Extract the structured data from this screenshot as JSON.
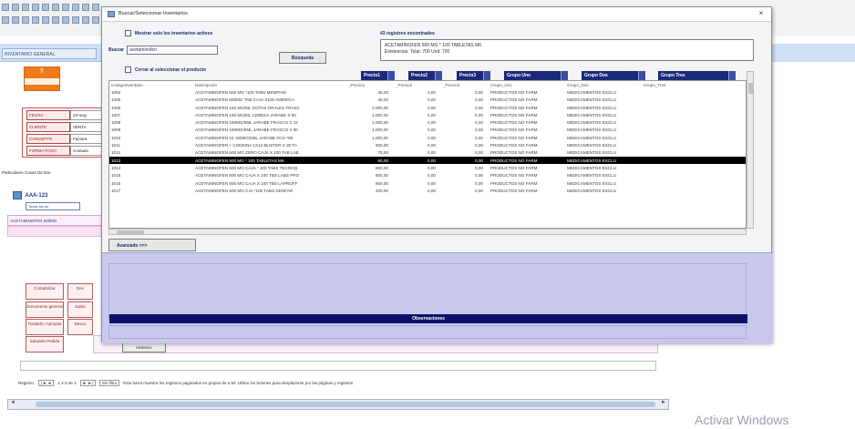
{
  "background": {
    "tab_button": "INVENTARIO GENERAL",
    "badge_top": "T",
    "badge_bottom": "",
    "form_rows": [
      {
        "label": "FECHA",
        "value": "23-may"
      },
      {
        "label": "CLIENTE",
        "value": "VENTA"
      },
      {
        "label": "CONCEPTO",
        "value": "Factura"
      },
      {
        "label": "FORMA PAGO",
        "value": "Contado"
      }
    ],
    "sub_label": "Particulares   Cosas De Dar",
    "account_code": "AAA-123",
    "account_select": "Todas las de",
    "product_row": "ACETAMINOFEN 500MG",
    "side_buttons": [
      {
        "label": "Contabilizar",
        "right": "Dev"
      },
      {
        "label": "Documento general",
        "right": "Gasto"
      },
      {
        "label": "Traslado / Apropiar",
        "right": "Descu"
      },
      {
        "label": "Subsidio Pedido",
        "right": ""
      }
    ],
    "obs_button": "Historico",
    "nav": {
      "label": "Registro:",
      "first": "|◄ ◄",
      "position": "1 2-3 de 3",
      "next": "► ►|",
      "filter": "Sin filtro",
      "message": "Esta barra muestra los registros paginados en grupos de a 50. Utilice los botones para desplazarse por las páginas y registros"
    },
    "watermark": "Activar Windows"
  },
  "modal": {
    "title": "Buscar/Seleccionar Inventarios",
    "close": "×",
    "only_active_label": "Mostrar solo los inventarios activos",
    "search_label": "Buscar",
    "search_value": "acetaminofen",
    "search_button": "Búsqueda",
    "close_on_select_label": "Cerrar al seleccionar el producto",
    "found_label": "43 registros encontrados",
    "found_lines": [
      "ACETAMINOFEN 500 MG * 100 TABLETAS MK",
      "Existencias: Total: 700   Und: 700"
    ],
    "columns": [
      {
        "label": "",
        "key": "code"
      },
      {
        "label": "",
        "key": "desc"
      },
      {
        "label": "Precio1",
        "key": "p1"
      },
      {
        "label": "Precio2",
        "key": "p2"
      },
      {
        "label": "Precio3",
        "key": "p3"
      },
      {
        "label": "Grupo Uno",
        "key": "g1"
      },
      {
        "label": "Grupo Dos",
        "key": "g2"
      },
      {
        "label": "Grupo Tres",
        "key": "g3"
      }
    ],
    "subheader": [
      "CodigoInventario",
      "Descripción",
      "_Precio1",
      "_Precio2",
      "_Precio3",
      "Grupo_Uno",
      "Grupo_Dos",
      "Grupo_Tres"
    ],
    "rows": [
      [
        "1004",
        "ACETAMINOFEN  500 MG *100 TABS MEMPHIS",
        "45,00",
        "0,00",
        "0,00",
        "PRODUCTOS NO FARM",
        "MEDICAMENTOS ESCLU",
        ""
      ],
      [
        "1005",
        "ACETAMINOFEN  500MG TAB CAJA X100 AMERICA",
        "45,00",
        "0,00",
        "0,00",
        "PRODUCTOS NO FARM",
        "MEDICAMENTOS ESCLU",
        ""
      ],
      [
        "1006",
        "ACETAMINOFEN 150 MG/ML GOTAS ORALES FRASC",
        "2.000,00",
        "0,00",
        "0,00",
        "PRODUCTOS NO FARM",
        "MEDICAMENTOS ESCLU",
        ""
      ],
      [
        "1007",
        "ACETAMINOFEN 150 MG/ML CEREZA JARABE X 90",
        "1.000,00",
        "0,00",
        "0,00",
        "PRODUCTOS NO FARM",
        "MEDICAMENTOS ESCLU",
        ""
      ],
      [
        "1008",
        "ACETAMINOFEN 160MG/5ML JARABE FRASCO X 12",
        "2.000,00",
        "0,00",
        "0,00",
        "PRODUCTOS NO FARM",
        "MEDICAMENTOS ESCLU",
        ""
      ],
      [
        "1009",
        "ACETAMINOFEN 160MG/5ML JARABE FRASCO X 90",
        "1.000,00",
        "0,00",
        "0,00",
        "PRODUCTOS NO FARM",
        "MEDICAMENTOS ESCLU",
        ""
      ],
      [
        "1010",
        "ACETAMINOFEN 24 160MG/5ML JARABE FCO *90",
        "1.000,00",
        "0,00",
        "0,00",
        "PRODUCTOS NO FARM",
        "MEDICAMENTOS ESCLU",
        ""
      ],
      [
        "1011",
        "ACETAMINOFEN + CODEINA 1X12 BLISTER X 30 TA",
        "500,00",
        "0,00",
        "0,00",
        "PRODUCTOS NO FARM",
        "MEDICAMENTOS ESCLU",
        ""
      ],
      [
        "1012",
        "ACETAMINOFEN 500 MG ZERO CAJA X 100 TAB LAB",
        "75,00",
        "0,00",
        "0,00",
        "PRODUCTOS NO FARM",
        "MEDICAMENTOS ESCLU",
        ""
      ],
      [
        "1013",
        "ACETAMINOFEN 500 MG * 100 TABLETAS MK",
        "60,00",
        "0,00",
        "0,00",
        "PRODUCTOS NO FARM",
        "MEDICAMENTOS ESCLU",
        ""
      ],
      [
        "1014",
        "ACETAMINOFEN 500 MG CAJA * 100 TABS TECNOQ",
        "800,00",
        "0,00",
        "0,00",
        "PRODUCTOS NO FARM",
        "MEDICAMENTOS ESCLU",
        ""
      ],
      [
        "1015",
        "ACETAMINOFEN 500 MG CAJA X 100 TBS LABS PRO",
        "800,00",
        "0,00",
        "0,00",
        "PRODUCTOS NO FARM",
        "MEDICAMENTOS ESCLU",
        ""
      ],
      [
        "1016",
        "ACETAMINOFEN 500 MG CAJA X 100 TBS LAPROFF",
        "800,00",
        "0,00",
        "0,00",
        "PRODUCTOS NO FARM",
        "MEDICAMENTOS ESCLU",
        ""
      ],
      [
        "1017",
        "ACETAMINOFEN 500 MG CJA *100 TABS GENFAR",
        "200,00",
        "0,00",
        "0,00",
        "PRODUCTOS NO FARM",
        "MEDICAMENTOS ESCLU",
        ""
      ]
    ],
    "selected_row_index": 9,
    "advanced_button": "Avanzado >>>",
    "observations_label": "Observaciones"
  }
}
